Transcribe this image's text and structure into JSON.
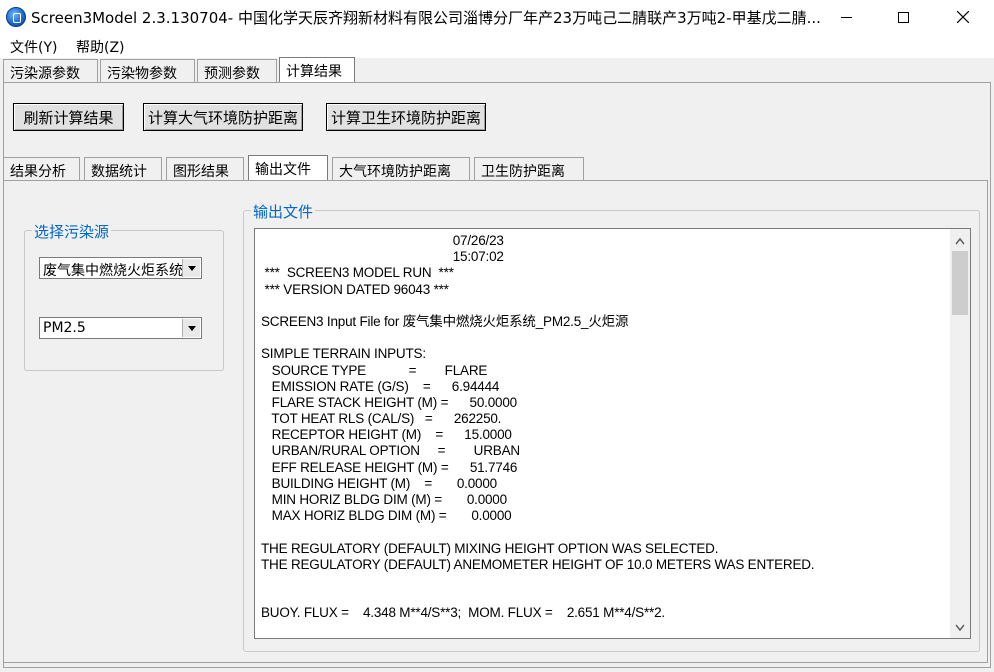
{
  "window": {
    "title": "Screen3Model 2.3.130704- 中国化学天辰齐翔新材料有限公司淄博分厂年产23万吨己二腈联产3万吨2-甲基戊二腈..."
  },
  "menu": {
    "file": "文件(Y)",
    "help": "帮助(Z)"
  },
  "main_tabs": [
    {
      "label": "污染源参数"
    },
    {
      "label": "污染物参数"
    },
    {
      "label": "预测参数"
    },
    {
      "label": "计算结果"
    }
  ],
  "toolbar": {
    "refresh": "刷新计算结果",
    "calc_air": "计算大气环境防护距离",
    "calc_health": "计算卫生环境防护距离"
  },
  "sub_tabs": [
    {
      "label": "结果分析"
    },
    {
      "label": "数据统计"
    },
    {
      "label": "图形结果"
    },
    {
      "label": "输出文件"
    },
    {
      "label": "大气环境防护距离"
    },
    {
      "label": "卫生防护距离"
    }
  ],
  "source_group": {
    "title": "选择污染源",
    "source_value": "废气集中燃烧火炬系统",
    "pollutant_value": "PM2.5"
  },
  "output_group": {
    "title": "输出文件"
  },
  "output_lines": [
    "                                                      07/26/23",
    "                                                      15:07:02",
    " ***  SCREEN3 MODEL RUN  ***",
    " *** VERSION DATED 96043 ***",
    "",
    "SCREEN3 Input File for 废气集中燃烧火炬系统_PM2.5_火炬源",
    "",
    "SIMPLE TERRAIN INPUTS:",
    "   SOURCE TYPE            =        FLARE",
    "   EMISSION RATE (G/S)    =      6.94444",
    "   FLARE STACK HEIGHT (M) =      50.0000",
    "   TOT HEAT RLS (CAL/S)   =      262250.",
    "   RECEPTOR HEIGHT (M)    =      15.0000",
    "   URBAN/RURAL OPTION     =        URBAN",
    "   EFF RELEASE HEIGHT (M) =      51.7746",
    "   BUILDING HEIGHT (M)    =       0.0000",
    "   MIN HORIZ BLDG DIM (M) =       0.0000",
    "   MAX HORIZ BLDG DIM (M) =       0.0000",
    "",
    "THE REGULATORY (DEFAULT) MIXING HEIGHT OPTION WAS SELECTED.",
    "THE REGULATORY (DEFAULT) ANEMOMETER HEIGHT OF 10.0 METERS WAS ENTERED.",
    "",
    "",
    "BUOY. FLUX =    4.348 M**4/S**3;  MOM. FLUX =    2.651 M**4/S**2."
  ]
}
